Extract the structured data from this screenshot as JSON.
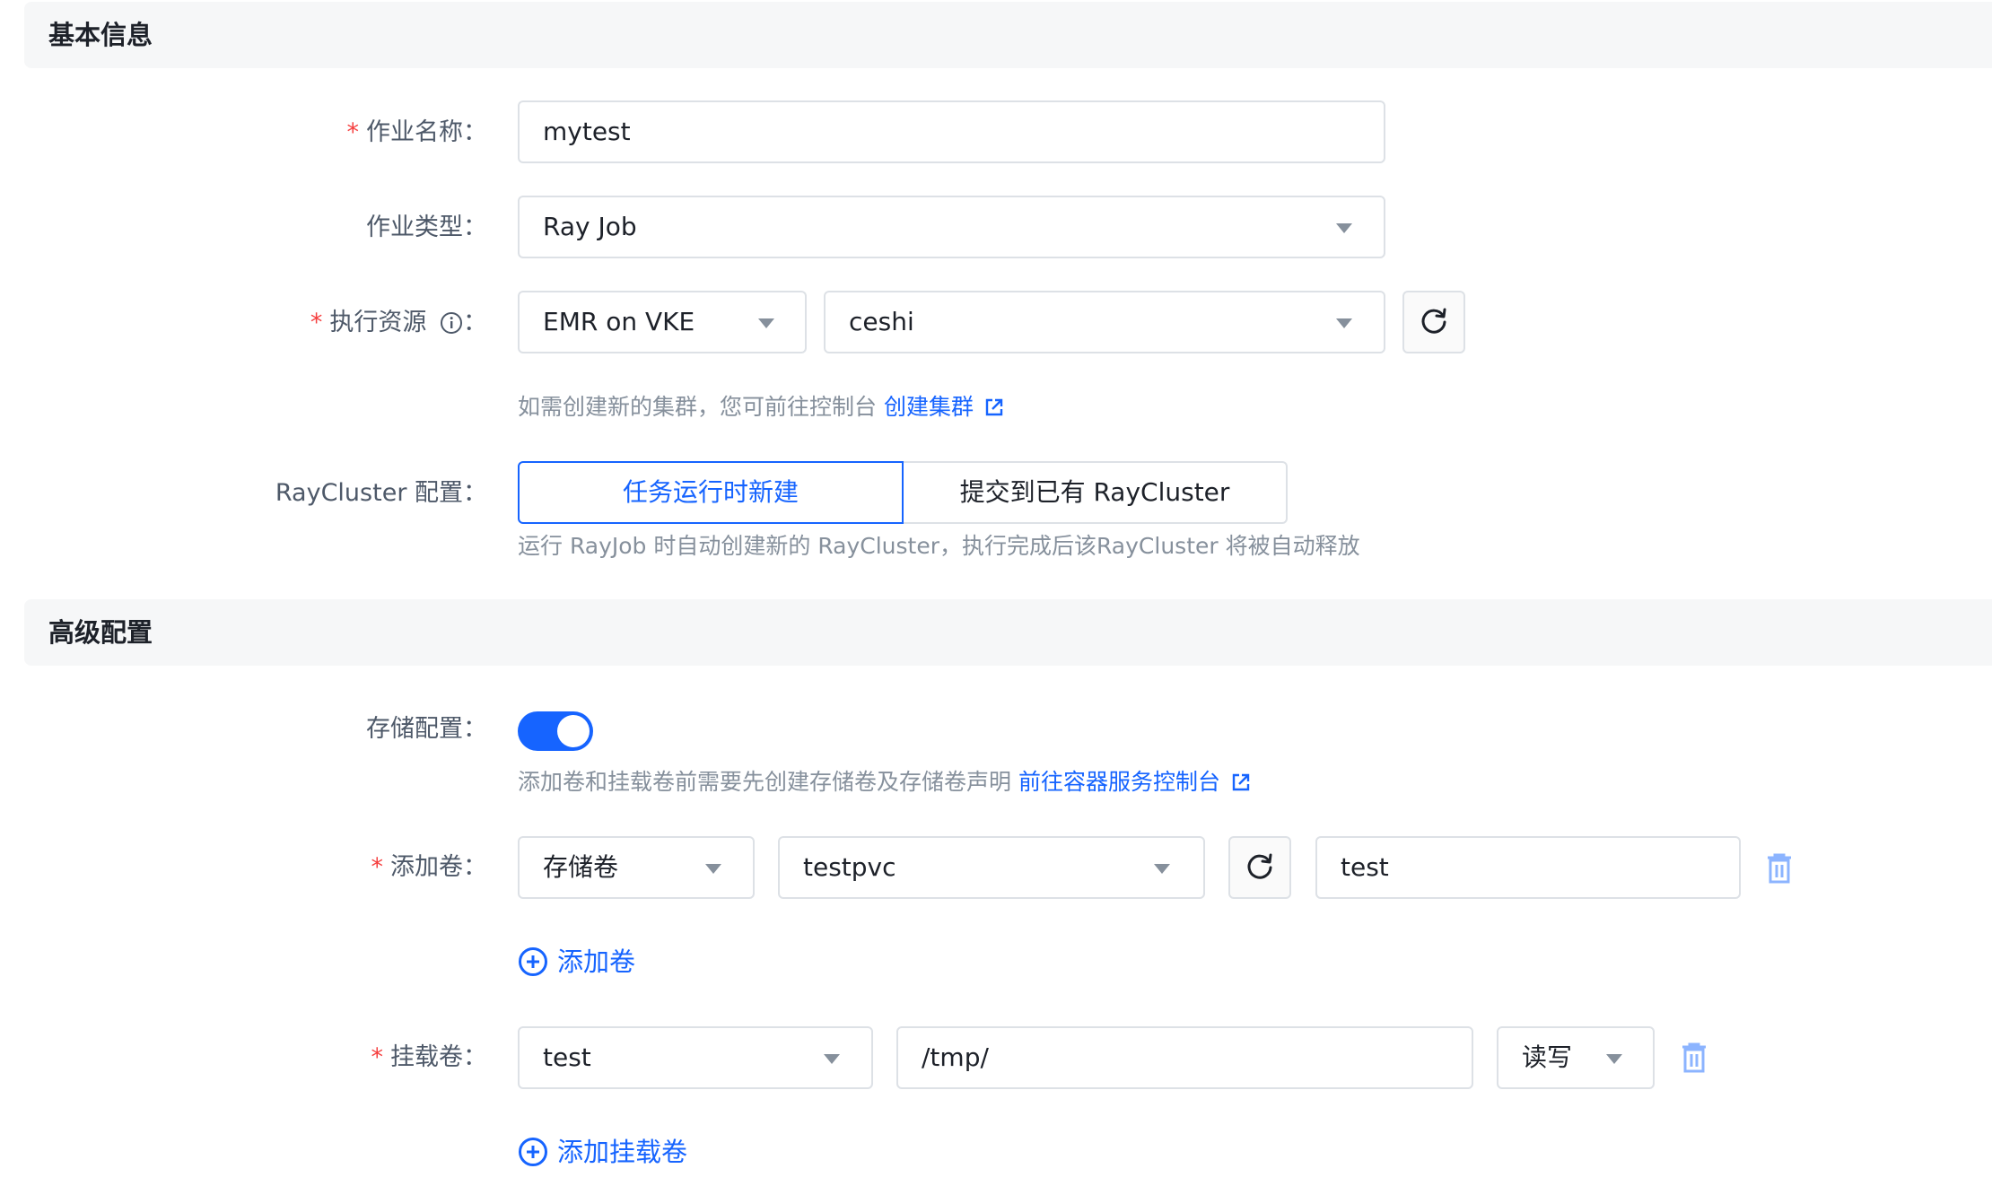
{
  "basic_section": {
    "title": "基本信息"
  },
  "job_name": {
    "label": "作业名称",
    "value": "mytest"
  },
  "job_type": {
    "label": "作业类型",
    "value": "Ray Job"
  },
  "exec_resource": {
    "label": "执行资源",
    "platform": "EMR on VKE",
    "cluster": "ceshi",
    "hint": "如需创建新的集群，您可前往控制台",
    "hint_link": "创建集群"
  },
  "raycluster": {
    "label": "RayCluster 配置",
    "option_new": "任务运行时新建",
    "option_existing": "提交到已有 RayCluster",
    "selected": "任务运行时新建",
    "hint": "运行 RayJob 时自动创建新的 RayCluster，执行完成后该RayCluster 将被自动释放"
  },
  "advanced_section": {
    "title": "高级配置"
  },
  "storage": {
    "label": "存储配置",
    "enabled": true,
    "hint": "添加卷和挂载卷前需要先创建存储卷及存储卷声明",
    "hint_link": "前往容器服务控制台"
  },
  "add_volume": {
    "label": "添加卷",
    "type": "存储卷",
    "pvc": "testpvc",
    "name": "test",
    "add_label": "添加卷"
  },
  "mount_volume": {
    "label": "挂载卷",
    "volume": "test",
    "path": "/tmp/",
    "mode": "读写",
    "add_label": "添加挂载卷"
  },
  "colors": {
    "primary": "#1664ff",
    "required": "#f53f3f",
    "section_bg": "#f6f7f8"
  }
}
